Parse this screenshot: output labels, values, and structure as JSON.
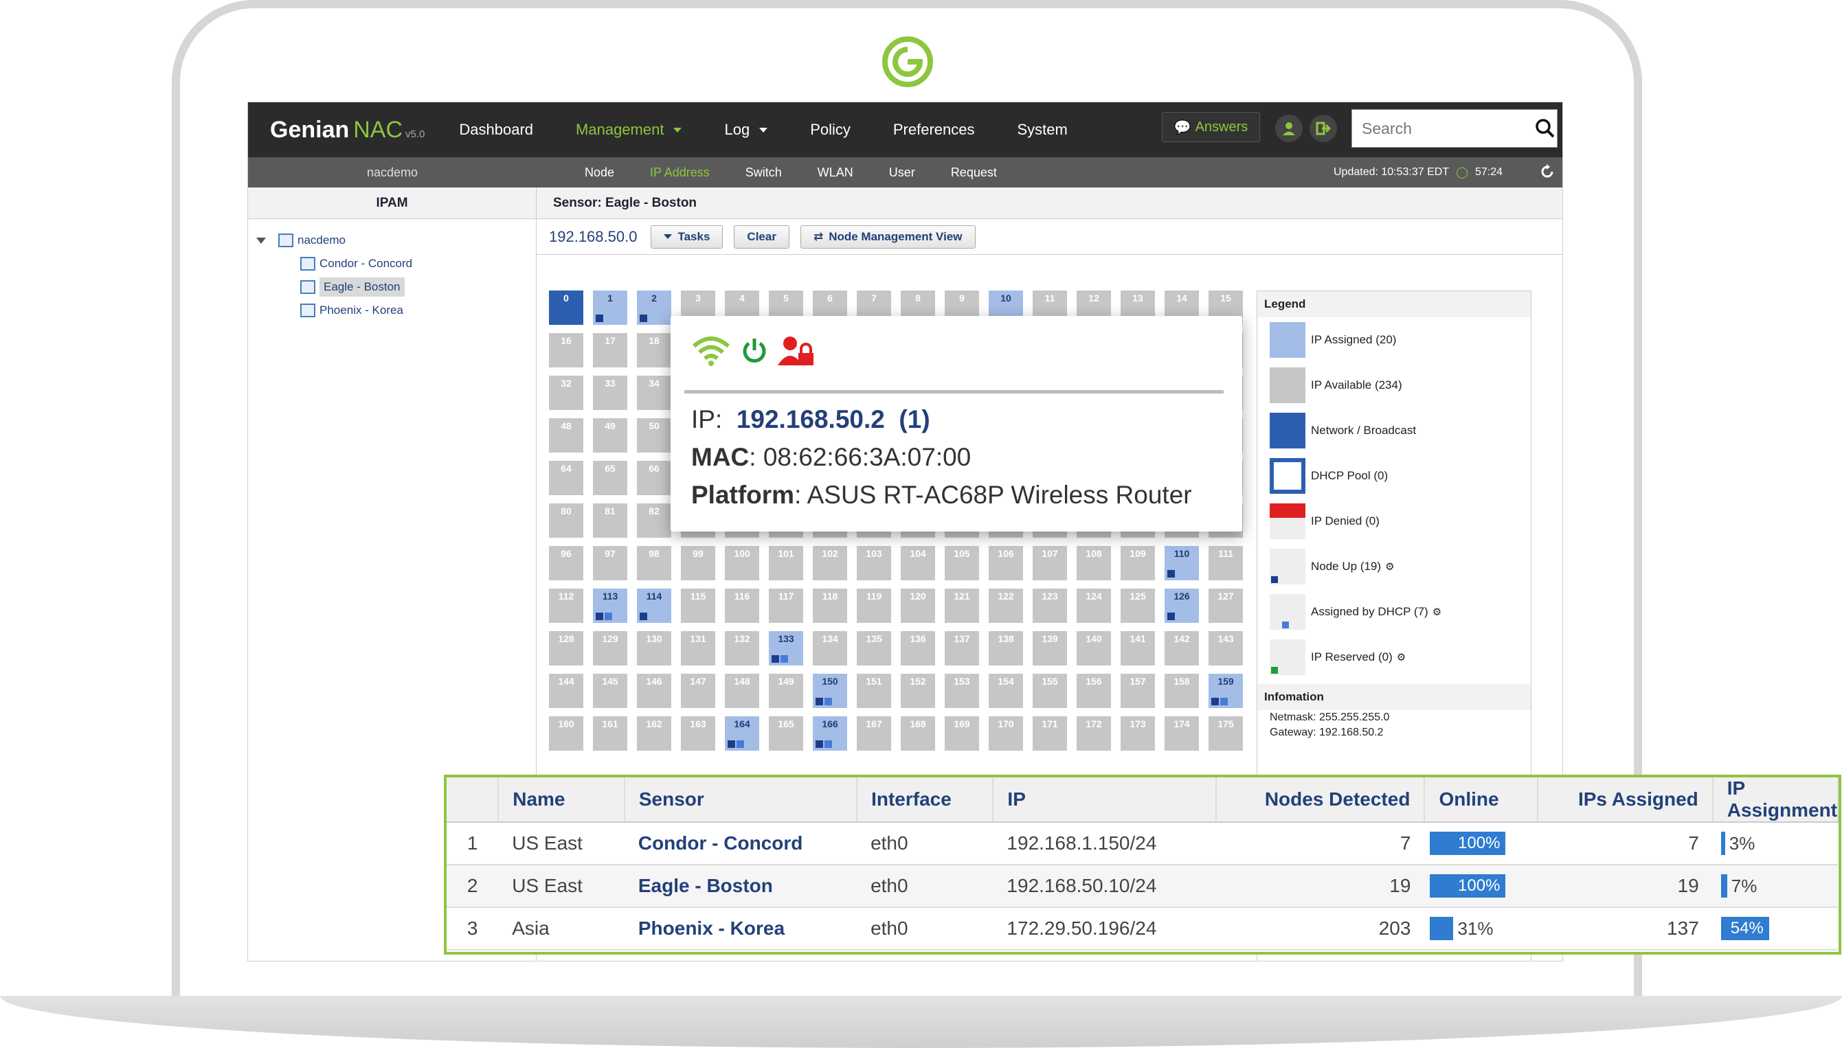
{
  "brand": {
    "name": "Genian",
    "product": "NAC",
    "version": "v5.0"
  },
  "nav": {
    "items": [
      {
        "label": "Dashboard",
        "active": false,
        "caret": false
      },
      {
        "label": "Management",
        "active": true,
        "caret": true
      },
      {
        "label": "Log",
        "active": false,
        "caret": true
      },
      {
        "label": "Policy",
        "active": false,
        "caret": false
      },
      {
        "label": "Preferences",
        "active": false,
        "caret": false
      },
      {
        "label": "System",
        "active": false,
        "caret": false
      }
    ],
    "answers_label": "Answers",
    "search_placeholder": "Search"
  },
  "subnav": {
    "site": "nacdemo",
    "items": [
      {
        "label": "Node",
        "active": false
      },
      {
        "label": "IP Address",
        "active": true
      },
      {
        "label": "Switch",
        "active": false
      },
      {
        "label": "WLAN",
        "active": false
      },
      {
        "label": "User",
        "active": false
      },
      {
        "label": "Request",
        "active": false
      }
    ],
    "updated": "Updated: 10:53:37 EDT",
    "timer": "57:24"
  },
  "left": {
    "title": "IPAM",
    "root": "nacdemo",
    "children": [
      "Condor - Concord",
      "Eagle - Boston",
      "Phoenix - Korea"
    ],
    "selected_index": 1
  },
  "right": {
    "title": "Sensor: Eagle - Boston",
    "network": "192.168.50.0",
    "buttons": {
      "tasks": "Tasks",
      "clear": "Clear",
      "node_view": "Node Management View"
    }
  },
  "ip_grid": {
    "columns": 16,
    "rows": 11,
    "network_cells": [
      0
    ],
    "assigned_cells": [
      1,
      2,
      10,
      110,
      113,
      114,
      126,
      133,
      150,
      159,
      164,
      166
    ],
    "marker_cells": {
      "1": 1,
      "2": 1,
      "110": 1,
      "113": 2,
      "114": 1,
      "126": 1,
      "133": 2,
      "150": 2,
      "159": 2,
      "164": 2,
      "166": 2
    }
  },
  "legend": {
    "title": "Legend",
    "items": [
      {
        "label": "IP Assigned (20)",
        "swatch": "#a4bde6",
        "gear": false
      },
      {
        "label": "IP Available (234)",
        "swatch": "#c6c6c6",
        "gear": false
      },
      {
        "label": "Network / Broadcast",
        "swatch": "#2d5fb0",
        "gear": false
      },
      {
        "label": "DHCP Pool (0)",
        "swatch": "dhcp",
        "gear": false
      },
      {
        "label": "IP Denied (0)",
        "swatch": "denied",
        "gear": false
      },
      {
        "label": "Node Up (19)",
        "swatch": "nodeup",
        "gear": true
      },
      {
        "label": "Assigned by DHCP (7)",
        "swatch": "dhcpassigned",
        "gear": true
      },
      {
        "label": "IP Reserved (0)",
        "swatch": "reserved",
        "gear": true
      }
    ],
    "info_title": "Infomation",
    "netmask": "Netmask: 255.255.255.0",
    "gateway": "Gateway: 192.168.50.2"
  },
  "popup": {
    "ip_label": "IP",
    "ip": "192.168.50.2",
    "ip_count": "(1)",
    "mac_label": "MAC",
    "mac": "08:62:66:3A:07:00",
    "platform_label": "Platform",
    "platform": "ASUS RT-AC68P Wireless Router",
    "icons": [
      "wifi-icon",
      "power-icon",
      "user-lock-icon"
    ]
  },
  "sensor_table": {
    "headers": [
      "",
      "Name",
      "Sensor",
      "Interface",
      "IP",
      "Nodes Detected",
      "Online",
      "IPs Assigned",
      "IP Assignment"
    ],
    "rows": [
      {
        "index": "1",
        "name": "US East",
        "sensor": "Condor - Concord",
        "interface": "eth0",
        "ip": "192.168.1.150/24",
        "nodes": "7",
        "online_pct": 100,
        "online": "100%",
        "ips_assigned": "7",
        "assign_pct": 3,
        "assign": "3%"
      },
      {
        "index": "2",
        "name": "US East",
        "sensor": "Eagle - Boston",
        "interface": "eth0",
        "ip": "192.168.50.10/24",
        "nodes": "19",
        "online_pct": 100,
        "online": "100%",
        "ips_assigned": "19",
        "assign_pct": 7,
        "assign": "7%"
      },
      {
        "index": "3",
        "name": "Asia",
        "sensor": "Phoenix - Korea",
        "interface": "eth0",
        "ip": "172.29.50.196/24",
        "nodes": "203",
        "online_pct": 31,
        "online": "31%",
        "ips_assigned": "137",
        "assign_pct": 54,
        "assign": "54%"
      }
    ]
  },
  "colors": {
    "accent": "#8dc63f",
    "link": "#23407a",
    "bar": "#2f7cd0"
  }
}
